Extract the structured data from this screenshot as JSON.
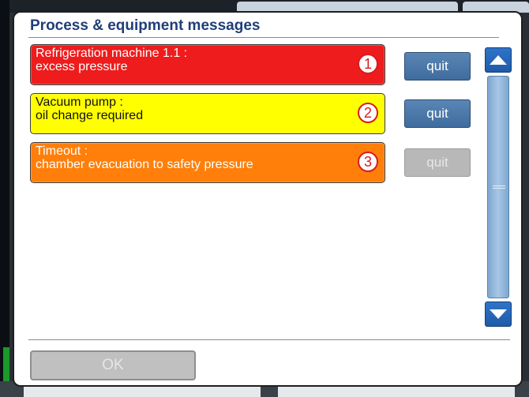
{
  "dialog": {
    "title": "Process & equipment messages"
  },
  "messages": [
    {
      "line1": "Refrigeration machine 1.1 :",
      "line2": "excess pressure",
      "number": "1",
      "color": "#ee1c1c",
      "quit_label": "quit",
      "quit_enabled": true
    },
    {
      "line1": "Vacuum pump :",
      "line2": "oil change required",
      "number": "2",
      "color": "#ffff00",
      "quit_label": "quit",
      "quit_enabled": true
    },
    {
      "line1": "Timeout :",
      "line2": "chamber evacuation to safety pressure",
      "number": "3",
      "color": "#ff7f0a",
      "quit_label": "quit",
      "quit_enabled": false
    }
  ],
  "scrollbar": {
    "up_icon": "triangle-up-icon",
    "down_icon": "triangle-down-icon"
  },
  "footer": {
    "ok_label": "OK",
    "ok_enabled": false
  },
  "colors": {
    "title": "#1f3f78",
    "button": "#3f6c9e",
    "scroll": "#2f74c8"
  }
}
